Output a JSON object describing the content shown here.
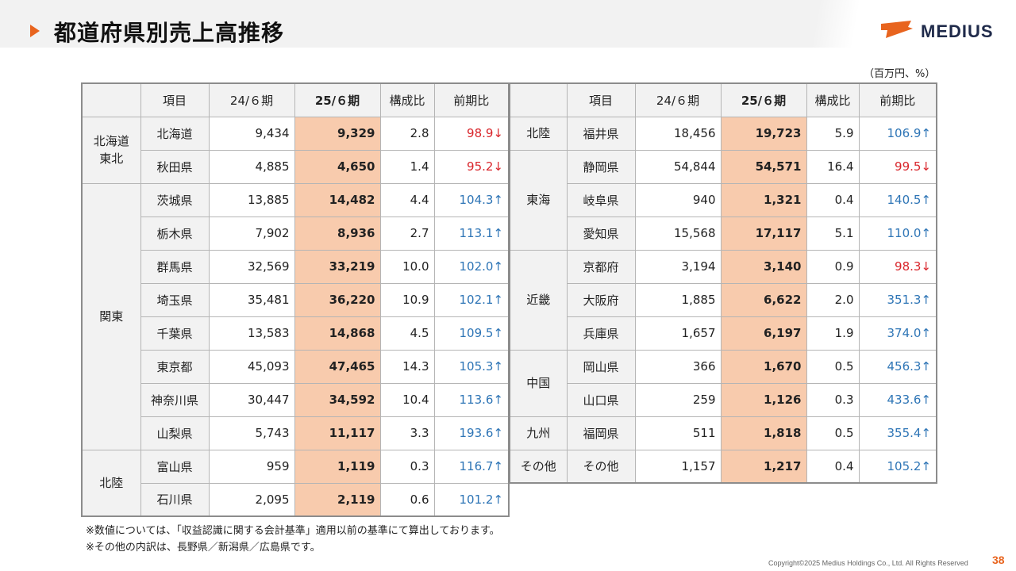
{
  "page": {
    "title": "都道府県別売上高推移",
    "brand": "MEDIUS",
    "unit_note": "（百万円、%）",
    "notes": [
      "※数値については、「収益認識に関する会計基準」適用以前の基準にて算出しております。",
      "※その他の内訳は、長野県／新潟県／広島県です。"
    ],
    "copyright": "Copyright©2025 Medius Holdings Co., Ltd. All Rights Reserved",
    "page_number": "38",
    "colors": {
      "accent": "#e8641e",
      "highlight": "#f8cbad",
      "up": "#2e75b6",
      "down": "#d9262c"
    }
  },
  "headers": [
    "項目",
    "24/６期",
    "25/６期",
    "構成比",
    "前期比"
  ],
  "left": {
    "groups": [
      {
        "region": "北海道\n東北",
        "rows": [
          {
            "name": "北海道",
            "prev": "9,434",
            "cur": "9,329",
            "ratio": "2.8",
            "yoy": "98.9↓",
            "dir": "down"
          },
          {
            "name": "秋田県",
            "prev": "4,885",
            "cur": "4,650",
            "ratio": "1.4",
            "yoy": "95.2↓",
            "dir": "down"
          }
        ]
      },
      {
        "region": "関東",
        "rows": [
          {
            "name": "茨城県",
            "prev": "13,885",
            "cur": "14,482",
            "ratio": "4.4",
            "yoy": "104.3↑",
            "dir": "up"
          },
          {
            "name": "栃木県",
            "prev": "7,902",
            "cur": "8,936",
            "ratio": "2.7",
            "yoy": "113.1↑",
            "dir": "up"
          },
          {
            "name": "群馬県",
            "prev": "32,569",
            "cur": "33,219",
            "ratio": "10.0",
            "yoy": "102.0↑",
            "dir": "up"
          },
          {
            "name": "埼玉県",
            "prev": "35,481",
            "cur": "36,220",
            "ratio": "10.9",
            "yoy": "102.1↑",
            "dir": "up"
          },
          {
            "name": "千葉県",
            "prev": "13,583",
            "cur": "14,868",
            "ratio": "4.5",
            "yoy": "109.5↑",
            "dir": "up"
          },
          {
            "name": "東京都",
            "prev": "45,093",
            "cur": "47,465",
            "ratio": "14.3",
            "yoy": "105.3↑",
            "dir": "up"
          },
          {
            "name": "神奈川県",
            "prev": "30,447",
            "cur": "34,592",
            "ratio": "10.4",
            "yoy": "113.6↑",
            "dir": "up"
          },
          {
            "name": "山梨県",
            "prev": "5,743",
            "cur": "11,117",
            "ratio": "3.3",
            "yoy": "193.6↑",
            "dir": "up"
          }
        ]
      },
      {
        "region": "北陸",
        "rows": [
          {
            "name": "富山県",
            "prev": "959",
            "cur": "1,119",
            "ratio": "0.3",
            "yoy": "116.7↑",
            "dir": "up"
          },
          {
            "name": "石川県",
            "prev": "2,095",
            "cur": "2,119",
            "ratio": "0.6",
            "yoy": "101.2↑",
            "dir": "up"
          }
        ]
      }
    ]
  },
  "right": {
    "groups": [
      {
        "region": "北陸",
        "rows": [
          {
            "name": "福井県",
            "prev": "18,456",
            "cur": "19,723",
            "ratio": "5.9",
            "yoy": "106.9↑",
            "dir": "up"
          }
        ]
      },
      {
        "region": "東海",
        "rows": [
          {
            "name": "静岡県",
            "prev": "54,844",
            "cur": "54,571",
            "ratio": "16.4",
            "yoy": "99.5↓",
            "dir": "down"
          },
          {
            "name": "岐阜県",
            "prev": "940",
            "cur": "1,321",
            "ratio": "0.4",
            "yoy": "140.5↑",
            "dir": "up"
          },
          {
            "name": "愛知県",
            "prev": "15,568",
            "cur": "17,117",
            "ratio": "5.1",
            "yoy": "110.0↑",
            "dir": "up"
          }
        ]
      },
      {
        "region": "近畿",
        "rows": [
          {
            "name": "京都府",
            "prev": "3,194",
            "cur": "3,140",
            "ratio": "0.9",
            "yoy": "98.3↓",
            "dir": "down"
          },
          {
            "name": "大阪府",
            "prev": "1,885",
            "cur": "6,622",
            "ratio": "2.0",
            "yoy": "351.3↑",
            "dir": "up"
          },
          {
            "name": "兵庫県",
            "prev": "1,657",
            "cur": "6,197",
            "ratio": "1.9",
            "yoy": "374.0↑",
            "dir": "up"
          }
        ]
      },
      {
        "region": "中国",
        "rows": [
          {
            "name": "岡山県",
            "prev": "366",
            "cur": "1,670",
            "ratio": "0.5",
            "yoy": "456.3↑",
            "dir": "up"
          },
          {
            "name": "山口県",
            "prev": "259",
            "cur": "1,126",
            "ratio": "0.3",
            "yoy": "433.6↑",
            "dir": "up"
          }
        ]
      },
      {
        "region": "九州",
        "rows": [
          {
            "name": "福岡県",
            "prev": "511",
            "cur": "1,818",
            "ratio": "0.5",
            "yoy": "355.4↑",
            "dir": "up"
          }
        ]
      },
      {
        "region": "その他",
        "rows": [
          {
            "name": "その他",
            "prev": "1,157",
            "cur": "1,217",
            "ratio": "0.4",
            "yoy": "105.2↑",
            "dir": "up"
          }
        ]
      }
    ]
  }
}
